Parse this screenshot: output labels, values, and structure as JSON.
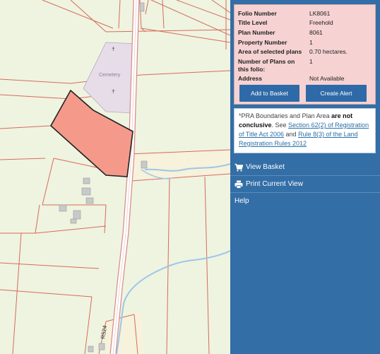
{
  "folio": {
    "rows": [
      {
        "label": "Folio Number",
        "value": "LK8061"
      },
      {
        "label": "Title Level",
        "value": "Freehold"
      },
      {
        "label": "Plan Number",
        "value": "8061"
      },
      {
        "label": "Property Number",
        "value": "1"
      },
      {
        "label": "Area of selected plans",
        "value": "0.70 hectares."
      },
      {
        "label": "Number of Plans on this folio:",
        "value": "1"
      },
      {
        "label": "Address",
        "value": "Not Available"
      }
    ],
    "add_to_basket": "Add to Basket",
    "create_alert": "Create Alert"
  },
  "disclaimer": {
    "part1": "*PRA Boundaries and Plan Area ",
    "bold": "are not conclusive",
    "part2": ". See ",
    "link1": "Section 62(2) of Registration of Title Act 2006",
    "part3": " and ",
    "link2": "Rule 8(3) of the Land Registration Rules 2012"
  },
  "nav": {
    "view_basket": "View Basket",
    "print_view": "Print Current View",
    "help": "Help"
  },
  "map": {
    "cemetery_label": "Cemetery",
    "road_label": "R524",
    "colors": {
      "background": "#eef4e0",
      "boundary": "#d86a5a",
      "selected_fill": "#f59a8a",
      "road": "#d88c8c",
      "river": "#9dc6e8"
    }
  }
}
